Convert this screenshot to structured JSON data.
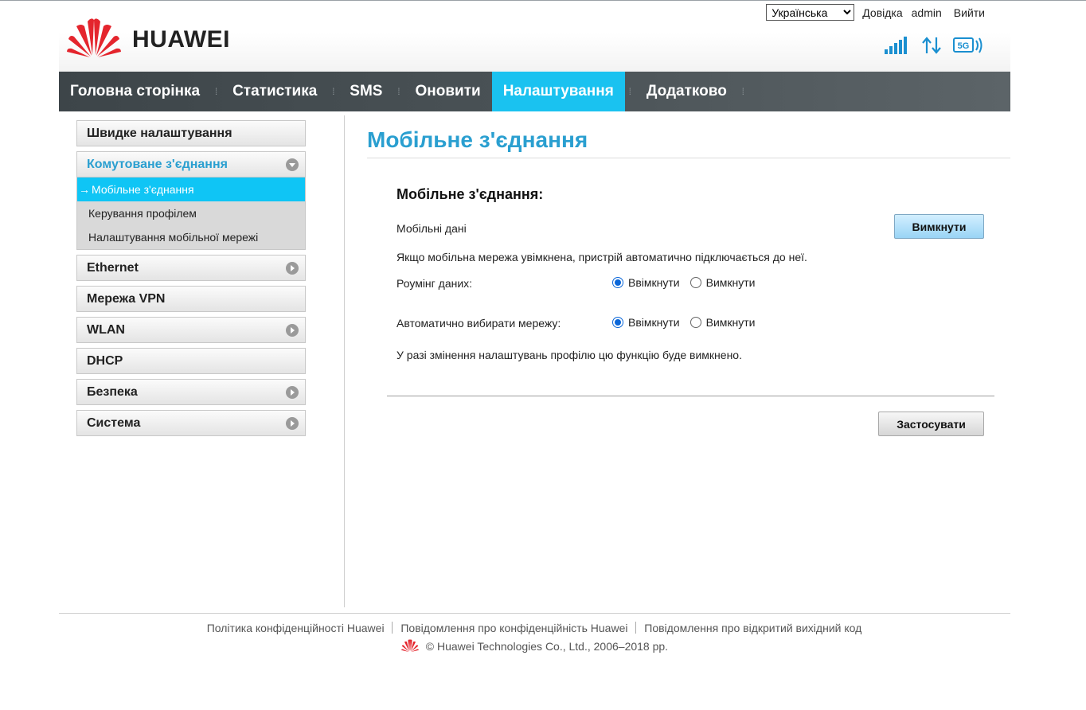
{
  "header": {
    "brand": "HUAWEI",
    "language": {
      "selected": "Українська",
      "options": [
        "Українська"
      ]
    },
    "links": {
      "help": "Довідка",
      "user": "admin",
      "logout": "Вийти"
    },
    "network_badge": "5G"
  },
  "nav": {
    "items": [
      {
        "label": "Головна сторінка"
      },
      {
        "label": "Статистика"
      },
      {
        "label": "SMS"
      },
      {
        "label": "Оновити"
      },
      {
        "label": "Налаштування",
        "active": true
      },
      {
        "label": "Додатково"
      }
    ]
  },
  "sidebar": {
    "items": [
      {
        "label": "Швидке налаштування"
      },
      {
        "label": "Комутоване з'єднання",
        "expanded": true,
        "children": [
          {
            "label": "Мобільне з'єднання",
            "active": true
          },
          {
            "label": "Керування профілем"
          },
          {
            "label": "Налаштування мобільної мережі"
          }
        ]
      },
      {
        "label": "Ethernet"
      },
      {
        "label": "Мережа VPN"
      },
      {
        "label": "WLAN"
      },
      {
        "label": "DHCP"
      },
      {
        "label": "Безпека"
      },
      {
        "label": "Система"
      }
    ],
    "active_arrow": "→"
  },
  "main": {
    "page_title": "Мобільне з'єднання",
    "section_title": "Мобільне з'єднання:",
    "mobile_data_label": "Мобільні дані",
    "mobile_data_button": "Вимкнути",
    "mobile_data_note": "Якщо мобільна мережа увімкнена, пристрій автоматично підключається до неї.",
    "roaming": {
      "label": "Роумінг даних:",
      "on": "Ввімкнути",
      "off": "Вимкнути",
      "selected": "on"
    },
    "auto_network": {
      "label": "Автоматично вибирати мережу:",
      "on": "Ввімкнути",
      "off": "Вимкнути",
      "selected": "on"
    },
    "profile_note": "У разі змінення налаштувань профілю цю функцію буде вимкнено.",
    "apply_button": "Застосувати"
  },
  "footer": {
    "links": [
      "Політика конфіденційності Huawei",
      "Повідомлення про конфіденційність Huawei",
      "Повідомлення про відкритий вихідний код"
    ],
    "copyright": "© Huawei Technologies Co., Ltd., 2006–2018 рр."
  },
  "colors": {
    "accent": "#2a9fd0",
    "nav_active": "#1ac2f0",
    "nav_bg": "#4a5256",
    "logo_red": "#e4252d"
  }
}
